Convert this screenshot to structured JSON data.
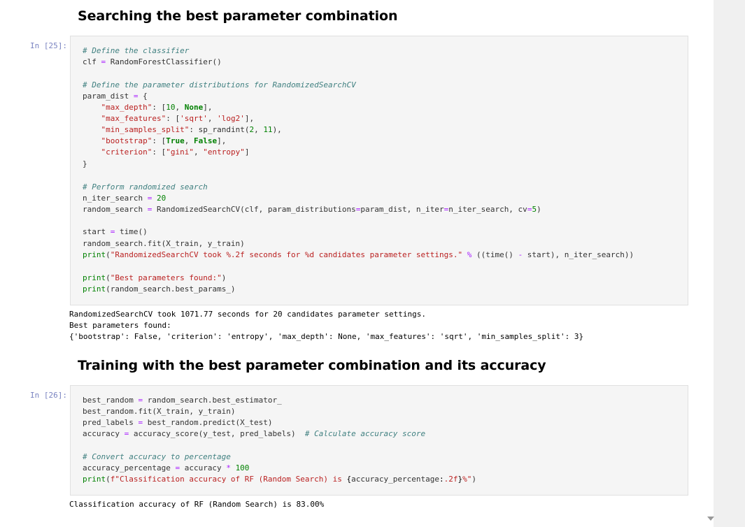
{
  "headings": {
    "h1": "Searching the best parameter combination",
    "h2": "Training with the best parameter combination and its accuracy"
  },
  "cells": {
    "cell25": {
      "prompt": "In [25]:",
      "code": [
        "# Define the classifier",
        "clf = RandomForestClassifier()",
        "",
        "# Define the parameter distributions for RandomizedSearchCV",
        "param_dist = {",
        "    \"max_depth\": [10, None],",
        "    \"max_features\": ['sqrt', 'log2'],",
        "    \"min_samples_split\": sp_randint(2, 11),",
        "    \"bootstrap\": [True, False],",
        "    \"criterion\": [\"gini\", \"entropy\"]",
        "}",
        "",
        "# Perform randomized search",
        "n_iter_search = 20",
        "random_search = RandomizedSearchCV(clf, param_distributions=param_dist, n_iter=n_iter_search, cv=5)",
        "",
        "start = time()",
        "random_search.fit(X_train, y_train)",
        "print(\"RandomizedSearchCV took %.2f seconds for %d candidates parameter settings.\" % ((time() - start), n_iter_search))",
        "",
        "print(\"Best parameters found:\")",
        "print(random_search.best_params_)"
      ],
      "output": [
        "RandomizedSearchCV took 1071.77 seconds for 20 candidates parameter settings.",
        "Best parameters found:",
        "{'bootstrap': False, 'criterion': 'entropy', 'max_depth': None, 'max_features': 'sqrt', 'min_samples_split': 3}"
      ]
    },
    "cell26": {
      "prompt": "In [26]:",
      "code": [
        "best_random = random_search.best_estimator_",
        "best_random.fit(X_train, y_train)",
        "pred_labels = best_random.predict(X_test)",
        "accuracy = accuracy_score(y_test, pred_labels)  # Calculate accuracy score",
        "",
        "# Convert accuracy to percentage",
        "accuracy_percentage = accuracy * 100",
        "print(f\"Classification accuracy of RF (Random Search) is {accuracy_percentage:.2f}%\")"
      ],
      "output": [
        "Classification accuracy of RF (Random Search) is 83.00%"
      ]
    }
  },
  "colors": {
    "comment": "#408080",
    "string": "#ba2121",
    "keyword": "#008000",
    "operator": "#aa22ff",
    "prompt": "#303f9f",
    "code_bg": "#f5f5f5"
  },
  "icons": {
    "scroll": "triangle-down-icon"
  }
}
